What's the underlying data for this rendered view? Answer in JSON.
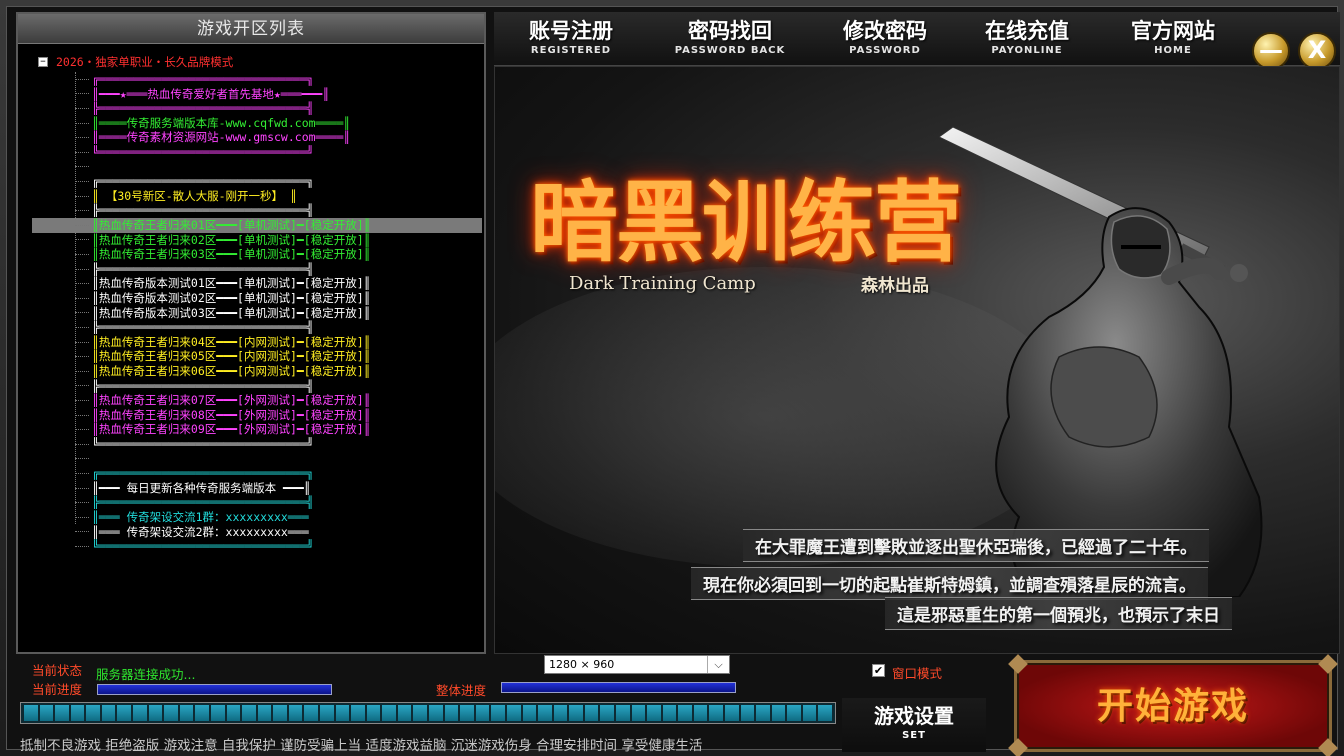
{
  "server_list": {
    "title": "游戏开区列表",
    "root_label": "2026・独家单职业・长久品牌模式",
    "rows": [
      {
        "text": "╔══════════════════════════════╗",
        "color": "#ff44ff"
      },
      {
        "text": "║━━━★═══热血传奇爱好者首先基地★═══━━━║",
        "color": "#ff44ff"
      },
      {
        "text": "╠══════════════════════════════╣",
        "color": "#ff44ff"
      },
      {
        "text": "║════传奇服务端版本库-www.cqfwd.com════║",
        "color": "#33ee33"
      },
      {
        "text": "║════传奇素材资源网站-www.gmscw.com════║",
        "color": "#ff44ff"
      },
      {
        "text": "╚══════════════════════════════╝",
        "color": "#ff44ff"
      },
      {
        "text": "",
        "color": "#ffffff"
      },
      {
        "text": "╔══════════════════════════════╗",
        "color": "#ffffff"
      },
      {
        "text": "║      【30号新区-散人大服-刚开一秒】      ║",
        "color": "#ffee22"
      },
      {
        "text": "╠══════════════════════════════╣",
        "color": "#ffffff"
      },
      {
        "text": "║热血传奇王者归来01区━━━[单机测试]━[稳定开放]║",
        "color": "#33ee33",
        "selected": true
      },
      {
        "text": "║热血传奇王者归来02区━━━[单机测试]━[稳定开放]║",
        "color": "#33ee33"
      },
      {
        "text": "║热血传奇王者归来03区━━━[单机测试]━[稳定开放]║",
        "color": "#33ee33"
      },
      {
        "text": "╠══════════════════════════════╣",
        "color": "#ffffff"
      },
      {
        "text": "║热血传奇版本测试01区━━━[单机测试]━[稳定开放]║",
        "color": "#ffffff"
      },
      {
        "text": "║热血传奇版本测试02区━━━[单机测试]━[稳定开放]║",
        "color": "#ffffff"
      },
      {
        "text": "║热血传奇版本测试03区━━━[单机测试]━[稳定开放]║",
        "color": "#ffffff"
      },
      {
        "text": "╠══════════════════════════════╣",
        "color": "#ffffff"
      },
      {
        "text": "║热血传奇王者归来04区━━━[内网测试]━[稳定开放]║",
        "color": "#ffee22"
      },
      {
        "text": "║热血传奇王者归来05区━━━[内网测试]━[稳定开放]║",
        "color": "#ffee22"
      },
      {
        "text": "║热血传奇王者归来06区━━━[内网测试]━[稳定开放]║",
        "color": "#ffee22"
      },
      {
        "text": "╠══════════════════════════════╣",
        "color": "#ffffff"
      },
      {
        "text": "║热血传奇王者归来07区━━━[外网测试]━[稳定开放]║",
        "color": "#ff44ff"
      },
      {
        "text": "║热血传奇王者归来08区━━━[外网测试]━[稳定开放]║",
        "color": "#ff44ff"
      },
      {
        "text": "║热血传奇王者归来09区━━━[外网测试]━[稳定开放]║",
        "color": "#ff44ff"
      },
      {
        "text": "╚══════════════════════════════╝",
        "color": "#ffffff"
      },
      {
        "text": "",
        "color": "#ffffff"
      },
      {
        "text": "╔══════════════════════════════╗",
        "color": "#22dddd"
      },
      {
        "text": "║━━━      每日更新各种传奇服务端版本      ━━━║",
        "color": "#ffffff"
      },
      {
        "text": "╠══════════════════════════════╣",
        "color": "#22dddd"
      },
      {
        "text": "║═══     传奇架设交流1群：xxxxxxxxx═══",
        "color": "#22dddd"
      },
      {
        "text": "║═══     传奇架设交流2群：xxxxxxxxx═══",
        "color": "#ffffff"
      },
      {
        "text": "╚══════════════════════════════╝",
        "color": "#22dddd"
      }
    ]
  },
  "nav": {
    "items": [
      {
        "zh": "账号注册",
        "en": "REGISTERED"
      },
      {
        "zh": "密码找回",
        "en": "PASSWORD BACK"
      },
      {
        "zh": "修改密码",
        "en": "PASSWORD"
      },
      {
        "zh": "在线充值",
        "en": "PAYONLINE"
      },
      {
        "zh": "官方网站",
        "en": "HOME"
      }
    ],
    "minimize": "—",
    "close": "X"
  },
  "banner": {
    "logo": "暗黑训练营",
    "logo_en": "Dark Training Camp",
    "logo_author": "森林出品",
    "lore": [
      "在大罪魔王遭到擊敗並逐出聖休亞瑞後，已經過了二十年。",
      "現在你必須回到一切的起點崔斯特姆鎮，並調查殞落星辰的流言。",
      "這是邪惡重生的第一個預兆，也預示了末日"
    ]
  },
  "status": {
    "state_label": "当前状态",
    "state_value": "服务器连接成功...",
    "progress_label": "当前进度",
    "overall_label": "整体进度",
    "current_progress": 1.0,
    "overall_progress": 1.0
  },
  "settings": {
    "resolution": "1280 × 960",
    "window_mode_label": "窗口模式",
    "window_mode_checked": true,
    "button_zh": "游戏设置",
    "button_en": "SET"
  },
  "notice": "抵制不良游戏  拒绝盗版  游戏注意  自我保护  谨防受骗上当  适度游戏益脑  沉迷游戏伤身  合理安排时间  享受健康生活",
  "start_button": "开始游戏",
  "colors": {
    "status_red": "#ff4a2a",
    "status_green": "#2ee62e",
    "progress_blue": "#1a28c8",
    "segment_cyan": "#2aa6c4"
  }
}
